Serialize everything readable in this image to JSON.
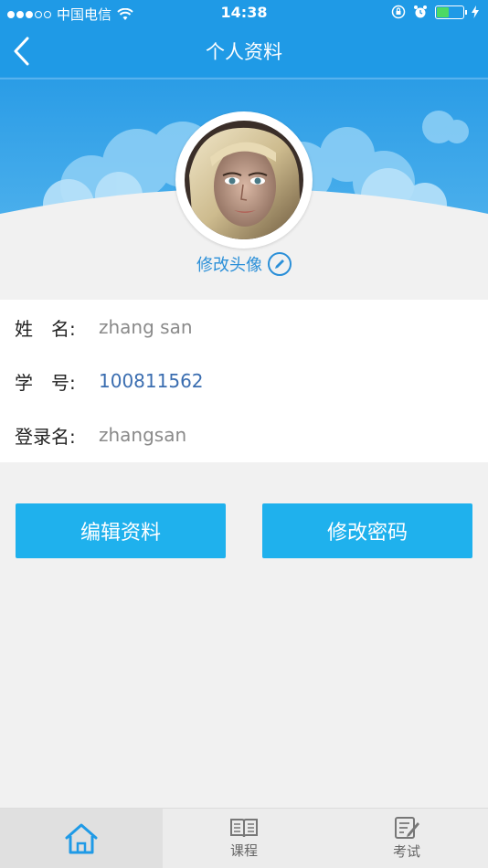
{
  "status_bar": {
    "carrier": "中国电信",
    "time": "14:38"
  },
  "nav": {
    "title": "个人资料",
    "back_icon": "chevron-left-icon"
  },
  "profile": {
    "edit_avatar_label": "修改头像",
    "edit_icon": "pencil-icon"
  },
  "info": {
    "rows": [
      {
        "label": "姓　名:",
        "value": "zhang san"
      },
      {
        "label": "学　号:",
        "value": "100811562"
      },
      {
        "label": "登录名:",
        "value": "zhangsan"
      }
    ]
  },
  "actions": {
    "edit_profile": "编辑资料",
    "change_password": "修改密码"
  },
  "tabs": [
    {
      "label": "",
      "icon": "home-icon",
      "active": true
    },
    {
      "label": "课程",
      "icon": "book-icon",
      "active": false
    },
    {
      "label": "考试",
      "icon": "exam-icon",
      "active": false
    }
  ],
  "colors": {
    "brand": "#1f9ae6",
    "button": "#1fb1ed",
    "link": "#2a8fd8"
  }
}
